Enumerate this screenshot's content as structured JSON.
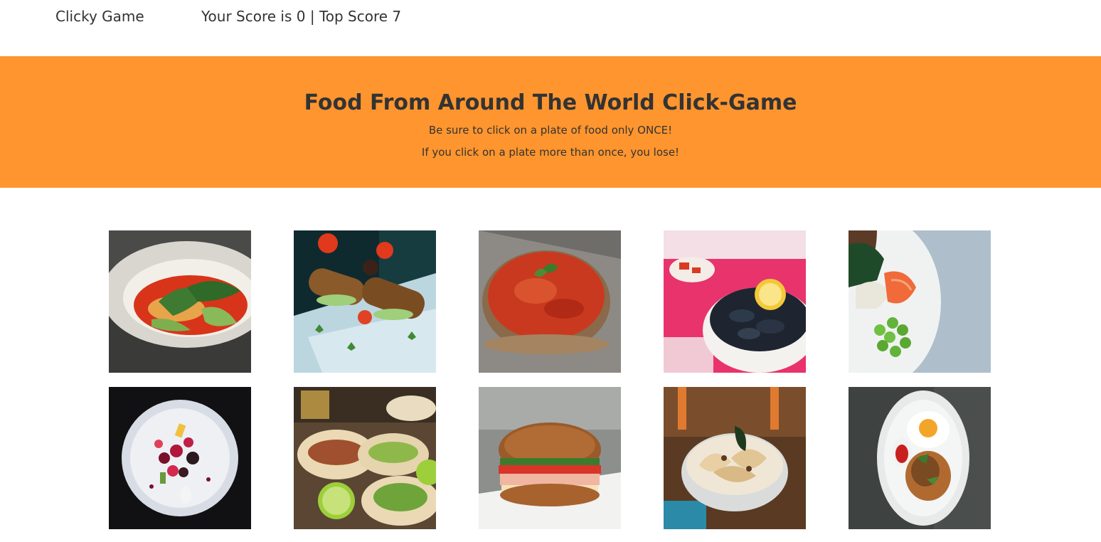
{
  "navbar": {
    "brand": "Clicky Game",
    "score_text": "Your Score is 0 | Top Score 7"
  },
  "hero": {
    "title": "Food From Around The World Click-Game",
    "line1": "Be sure to click on a plate of food only ONCE!",
    "line2": "If you click on a plate more than once, you lose!"
  },
  "colors": {
    "hero_background": "#ff952e"
  },
  "cards": [
    {
      "name": "noodle-soup-image"
    },
    {
      "name": "sesame-skewers-image"
    },
    {
      "name": "tomato-tart-image"
    },
    {
      "name": "mussels-image"
    },
    {
      "name": "salmon-bowl-image"
    },
    {
      "name": "berry-salad-image"
    },
    {
      "name": "tacos-image"
    },
    {
      "name": "sandwich-image"
    },
    {
      "name": "pasta-bowl-image"
    },
    {
      "name": "egg-plate-image"
    }
  ]
}
